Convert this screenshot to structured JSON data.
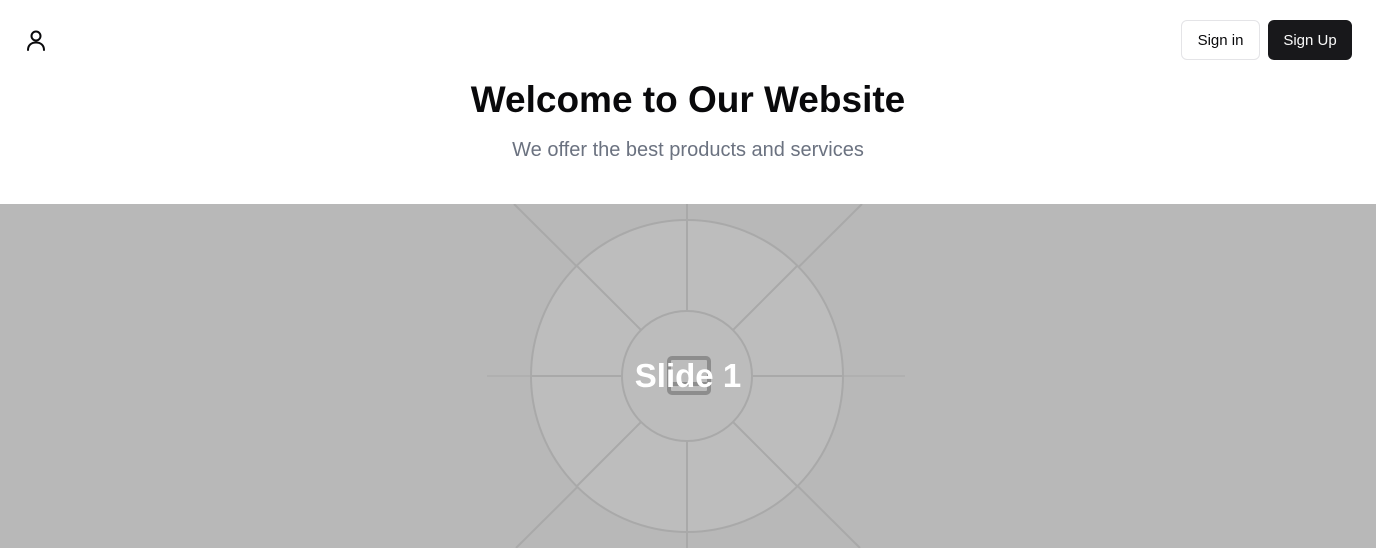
{
  "header": {
    "user_icon": "user-icon",
    "signin_label": "Sign in",
    "signup_label": "Sign Up"
  },
  "hero": {
    "title": "Welcome to Our Website",
    "subtitle": "We offer the best products and services"
  },
  "carousel": {
    "slide_label": "Slide 1",
    "placeholder_icon": "image-placeholder-icon"
  },
  "colors": {
    "primary_button": "#18181b",
    "subtitle_text": "#6b7280",
    "carousel_background": "#b8b8b8"
  }
}
